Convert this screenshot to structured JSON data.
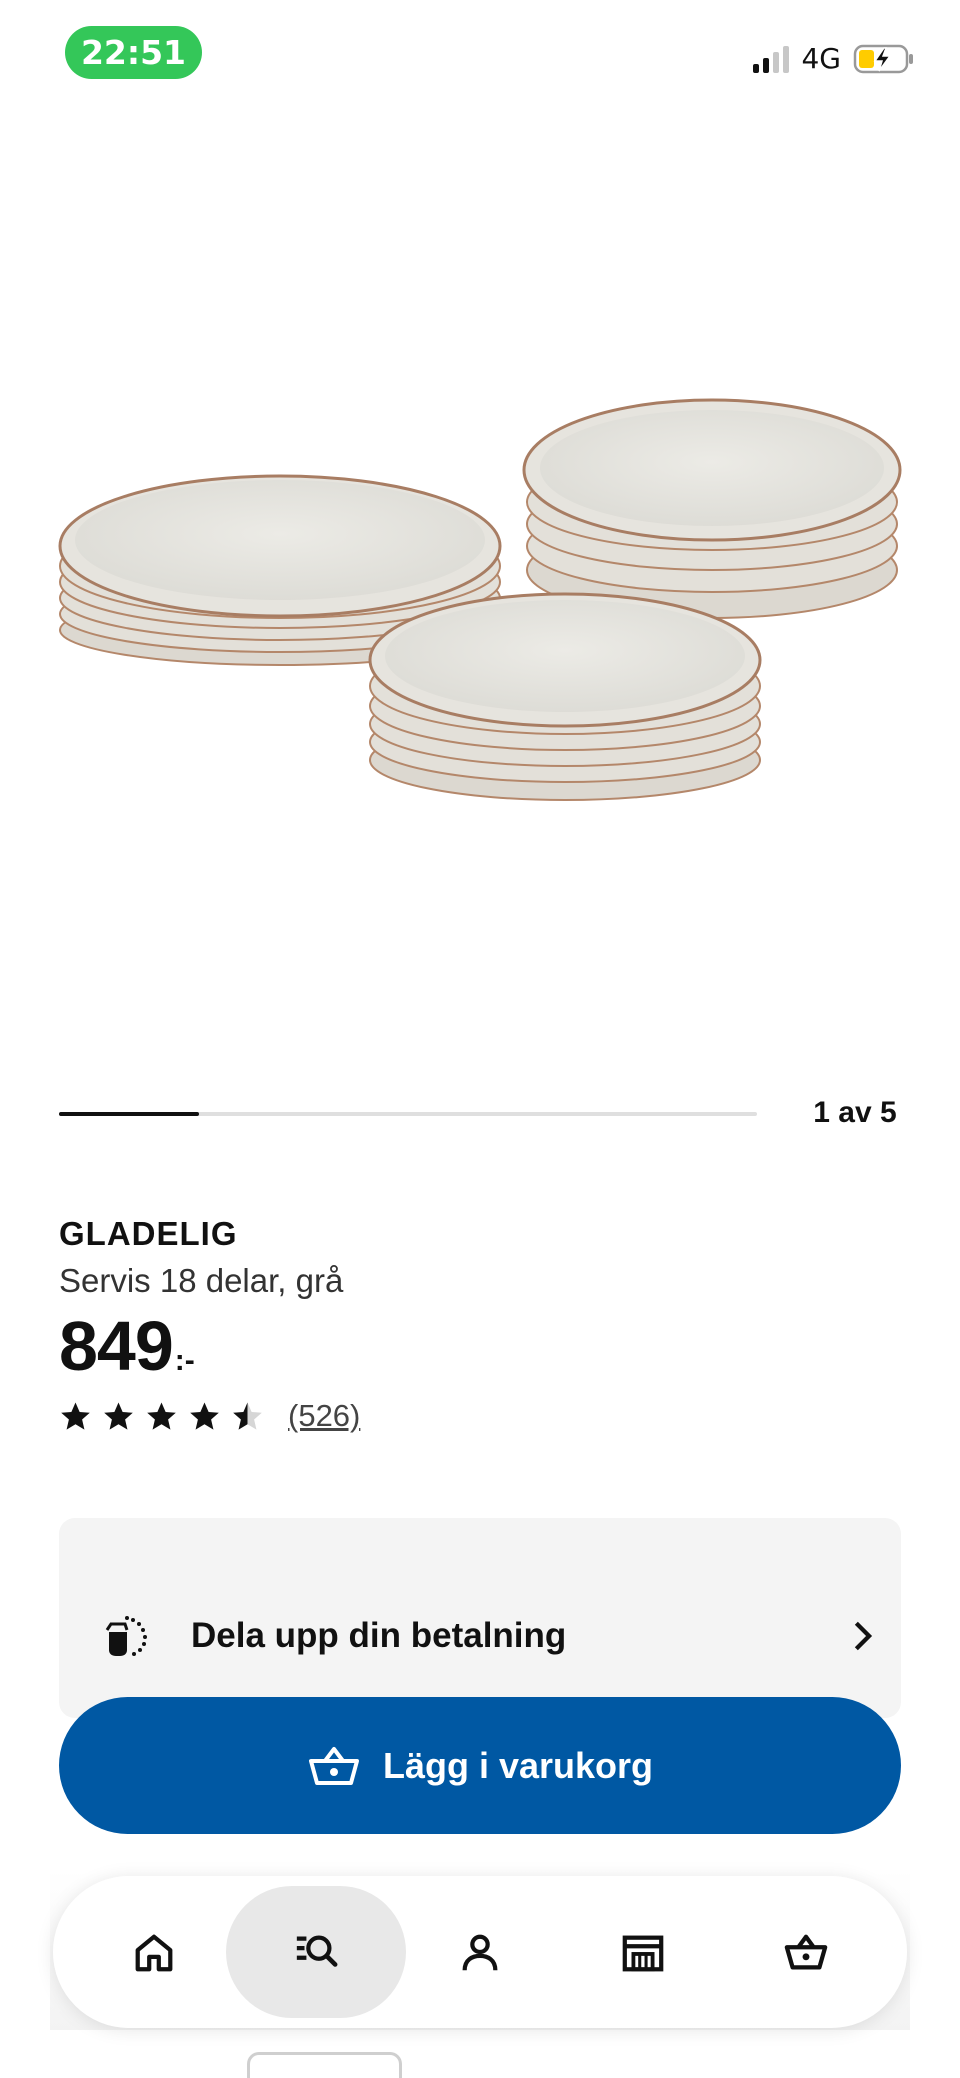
{
  "status_bar": {
    "time": "22:51",
    "network": "4G",
    "signal_bars_filled": 2,
    "battery": "charging"
  },
  "gallery": {
    "counter": "1 av 5",
    "progress_fraction": 0.2
  },
  "product": {
    "brand": "GLADELIG",
    "description": "Servis 18 delar, grå",
    "price": "849",
    "price_suffix": ":-",
    "rating": 4.5,
    "review_count": "(526)"
  },
  "payment": {
    "label": "Dela upp din betalning",
    "icon": "split-payment-icon"
  },
  "cart_button": {
    "label": "Lägg i varukorg",
    "icon": "basket-icon"
  },
  "tabs": [
    {
      "name": "home",
      "icon": "home-icon",
      "active": false
    },
    {
      "name": "search",
      "icon": "search-icon",
      "active": true
    },
    {
      "name": "profile",
      "icon": "profile-icon",
      "active": false
    },
    {
      "name": "stores",
      "icon": "store-icon",
      "active": false
    },
    {
      "name": "cart",
      "icon": "basket-icon",
      "active": false
    }
  ],
  "colors": {
    "primary_blue": "#0058a3",
    "status_green": "#34c759",
    "battery_yellow": "#ffcc00",
    "card_gray": "#f4f4f4"
  }
}
